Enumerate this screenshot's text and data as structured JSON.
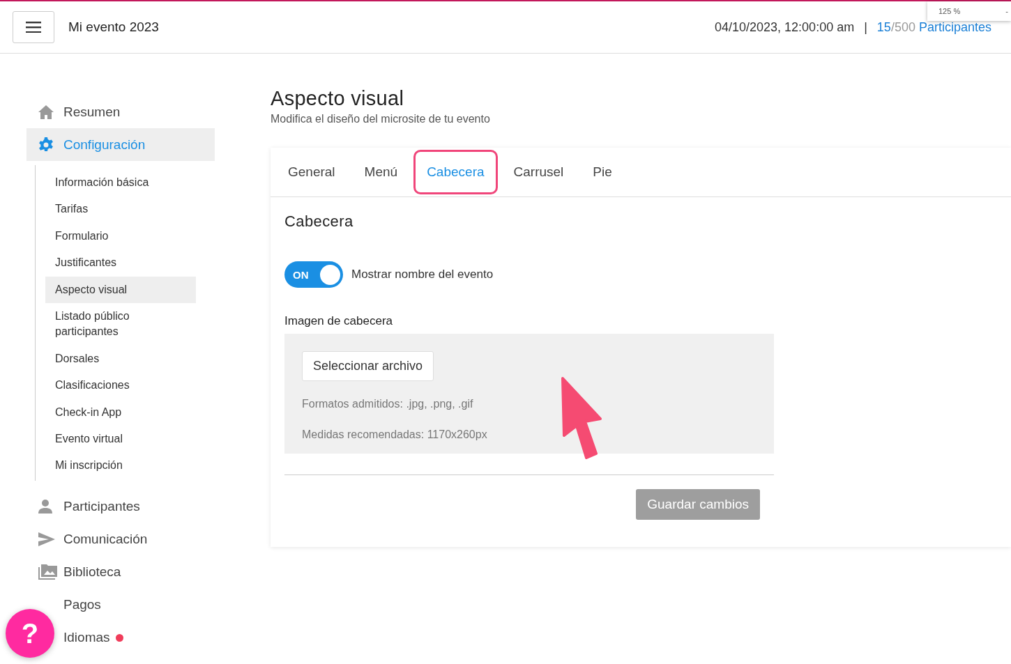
{
  "header": {
    "title": "Mi evento 2023",
    "datetime": "04/10/2023, 12:00:00 am",
    "separator": "|",
    "count": "15",
    "total": "/500",
    "participants_link": "Participantes",
    "zoom_popup": "125 %",
    "zoom_minus": "-"
  },
  "sidebar": {
    "items": [
      {
        "label": "Resumen",
        "selected": false,
        "alert": false
      },
      {
        "label": "Configuración",
        "selected": true,
        "alert": false,
        "children": [
          {
            "label": "Información básica",
            "selected": false
          },
          {
            "label": "Tarifas",
            "selected": false
          },
          {
            "label": "Formulario",
            "selected": false
          },
          {
            "label": "Justificantes",
            "selected": false
          },
          {
            "label": "Aspecto visual",
            "selected": true
          },
          {
            "label": "Listado público participantes",
            "selected": false
          },
          {
            "label": "Dorsales",
            "selected": false
          },
          {
            "label": "Clasificaciones",
            "selected": false
          },
          {
            "label": "Check-in App",
            "selected": false
          },
          {
            "label": "Evento virtual",
            "selected": false
          },
          {
            "label": "Mi inscripción",
            "selected": false
          }
        ]
      },
      {
        "label": "Participantes",
        "selected": false,
        "alert": false
      },
      {
        "label": "Comunicación",
        "selected": false,
        "alert": false
      },
      {
        "label": "Biblioteca",
        "selected": false,
        "alert": false
      },
      {
        "label": "Pagos",
        "selected": false,
        "alert": false
      },
      {
        "label": "Idiomas",
        "selected": false,
        "alert": true
      }
    ]
  },
  "page": {
    "title": "Aspecto visual",
    "subtitle": "Modifica el diseño del microsite de tu evento"
  },
  "tabs": [
    {
      "label": "General",
      "selected": false,
      "highlighted": false
    },
    {
      "label": "Menú",
      "selected": false,
      "highlighted": false
    },
    {
      "label": "Cabecera",
      "selected": true,
      "highlighted": true
    },
    {
      "label": "Carrusel",
      "selected": false,
      "highlighted": false
    },
    {
      "label": "Pie",
      "selected": false,
      "highlighted": false
    }
  ],
  "section": {
    "title": "Cabecera",
    "toggle": {
      "text": "ON",
      "on": true,
      "label": "Mostrar nombre del evento"
    },
    "image_label": "Imagen de cabecera",
    "file_button": "Seleccionar archivo",
    "formats": "Formatos admitidos: .jpg, .png, .gif",
    "sizes": "Medidas recomendadas: 1170x260px",
    "save_button": {
      "label": "Guardar cambios",
      "disabled": true
    }
  },
  "help_button": "?"
}
